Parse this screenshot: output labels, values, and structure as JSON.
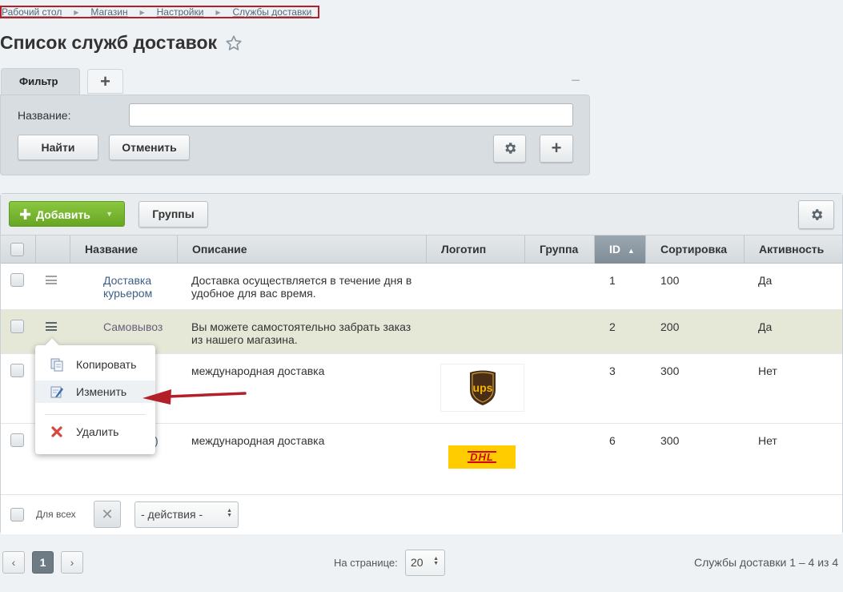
{
  "breadcrumb": [
    "Рабочий стол",
    "Магазин",
    "Настройки",
    "Службы доставки"
  ],
  "page_title": "Список служб доставок",
  "filter": {
    "tab_label": "Фильтр",
    "add_tab": "+",
    "collapse": "−",
    "name_label": "Название:",
    "name_value": "",
    "find_label": "Найти",
    "cancel_label": "Отменить",
    "plus_label": "+"
  },
  "toolbar": {
    "add_label": "Добавить",
    "groups_label": "Группы"
  },
  "table": {
    "columns": [
      "Название",
      "Описание",
      "Логотип",
      "Группа",
      "ID",
      "Сортировка",
      "Активность"
    ],
    "sort_indicator": "▲",
    "rows": [
      {
        "name_l1": "Доставка",
        "name_l2": "курьером",
        "desc_l1": "Доставка осуществляется в течение дня в",
        "desc_l2": "удобное для вас время.",
        "logo": "",
        "group": "",
        "id": "1",
        "sort": "100",
        "active": "Да"
      },
      {
        "name_l1": "Самовывоз",
        "name_l2": "",
        "desc_l1": "Вы можете самостоятельно забрать заказ",
        "desc_l2": "из нашего магазина.",
        "logo": "",
        "group": "",
        "id": "2",
        "sort": "200",
        "active": "Да"
      },
      {
        "name_l1": "",
        "name_l2": "",
        "desc_l1": "международная доставка",
        "desc_l2": "",
        "logo": "ups",
        "group": "",
        "id": "3",
        "sort": "300",
        "active": "Нет"
      },
      {
        "name_l1": ")",
        "name_l2": "",
        "desc_l1": "международная доставка",
        "desc_l2": "",
        "logo": "dhl",
        "group": "",
        "id": "6",
        "sort": "300",
        "active": "Нет"
      }
    ],
    "logo_text": {
      "ups": "ups",
      "dhl": "DHL"
    }
  },
  "footer": {
    "for_all": "Для всех",
    "clear": "✕",
    "actions": "- действия -"
  },
  "pagination": {
    "prev": "‹",
    "current": "1",
    "next": "›",
    "per_page_label": "На странице:",
    "per_page_value": "20",
    "summary": "Службы доставки 1 – 4 из 4"
  },
  "context_menu": {
    "items": [
      "Копировать",
      "Изменить",
      "Удалить"
    ],
    "active_index": 1
  },
  "colors": {
    "accent_green": "#7bbd34",
    "highlight_row": "#e5e8d7",
    "annotation_red": "#b3202a",
    "link": "#3b5f87"
  }
}
